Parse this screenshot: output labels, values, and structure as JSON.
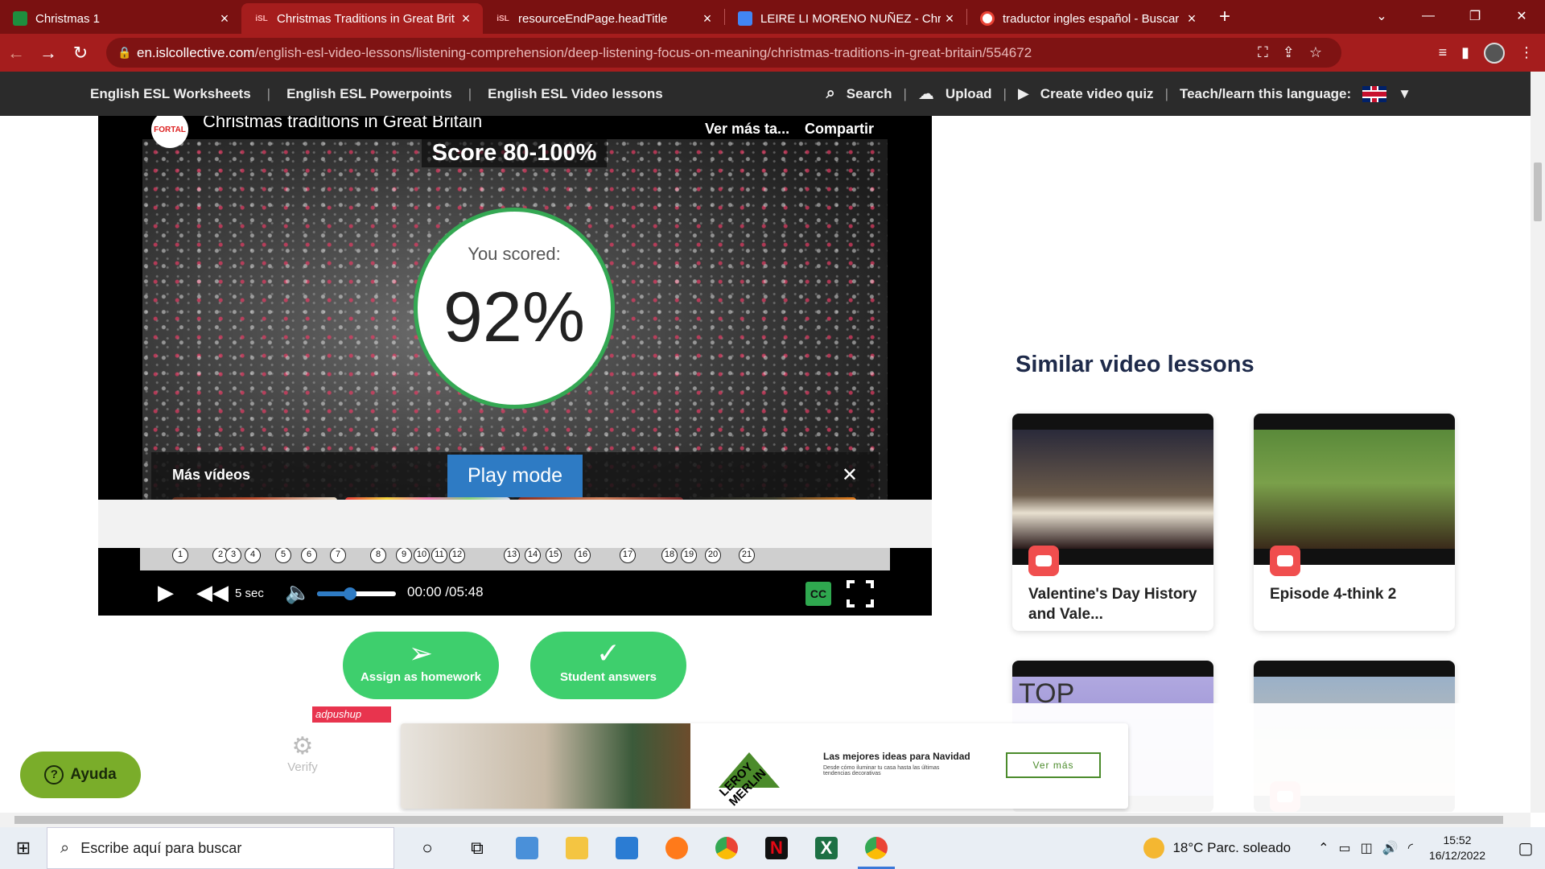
{
  "browser": {
    "tabs": [
      {
        "title": "Christmas 1",
        "favicon": "sheets-icon",
        "active": false
      },
      {
        "title": "Christmas Traditions in Great Brit",
        "favicon": "isl",
        "active": true
      },
      {
        "title": "resourceEndPage.headTitle",
        "favicon": "isl",
        "active": false
      },
      {
        "title": "LEIRE LI MORENO NUÑEZ - Chris",
        "favicon": "docs-icon",
        "active": false
      },
      {
        "title": "traductor ingles español - Buscar",
        "favicon": "google-icon",
        "active": false
      }
    ],
    "favicon_text_isl": "iSL",
    "tab_close": "×",
    "new_tab": "+",
    "url_host": "en.islcollective.com",
    "url_path": "/english-esl-video-lessons/listening-comprehension/deep-listening-focus-on-meaning/christmas-traditions-in-great-britain/554672"
  },
  "sitenav": {
    "left": [
      "English ESL Worksheets",
      "English ESL Powerpoints",
      "English ESL Video lessons"
    ],
    "search": "Search",
    "upload": "Upload",
    "create_quiz": "Create video quiz",
    "teach": "Teach/learn this language:"
  },
  "player": {
    "channel_logo": "FORTAL",
    "video_title": "Christmas traditions in Great Britain",
    "ver_mas": "Ver más ta...",
    "compartir": "Compartir",
    "score_banner": "Score 80-100%",
    "you_scored": "You scored:",
    "score_value": "92%",
    "more_videos": "Más vídeos",
    "play_mode": "Play mode",
    "question_marks": [
      "1",
      "2",
      "3",
      "4",
      "5",
      "6",
      "7",
      "8",
      "9",
      "10",
      "11",
      "12",
      "13",
      "14",
      "15",
      "16",
      "17",
      "18",
      "19",
      "20",
      "21"
    ],
    "skip_label": "5 sec",
    "time": "00:00 /05:48",
    "volume_fraction": 0.42,
    "cc": "CC"
  },
  "actions": {
    "assign": "Assign as homework",
    "answers": "Student answers"
  },
  "sidebar": {
    "title": "Similar video lessons",
    "cards": [
      {
        "title": "Valentine's Day History and Vale..."
      },
      {
        "title": "Episode 4-think 2"
      },
      {
        "title": "TOP"
      },
      {
        "title": ""
      }
    ]
  },
  "ad": {
    "badge": "adpushup",
    "brand": "LEROY MERLIN",
    "headline": "Las mejores ideas para Navidad",
    "subtext": "Desde cómo iluminar tu casa hasta las últimas tendencias decorativas",
    "cta": "Ver más"
  },
  "verify": "Verify",
  "ayuda": "Ayuda",
  "taskbar": {
    "search_placeholder": "Escribe aquí para buscar",
    "weather": "18°C  Parc. soleado",
    "time": "15:52",
    "date": "16/12/2022"
  },
  "colors": {
    "chrome_red": "#a51d1d",
    "accent_green": "#3ecf6d",
    "score_green": "#34a853",
    "play_mode_blue": "#2e7bc4"
  }
}
